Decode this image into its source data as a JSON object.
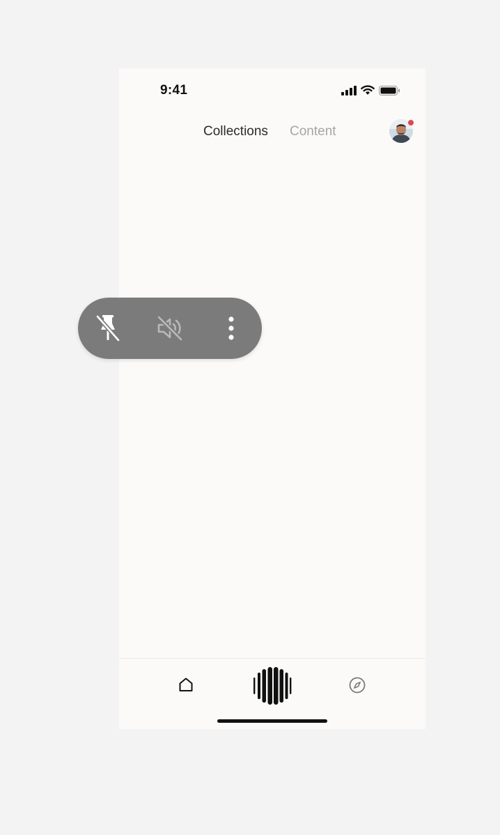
{
  "status_bar": {
    "time": "9:41",
    "icons": [
      "cellular-signal-icon",
      "wifi-icon",
      "battery-icon"
    ]
  },
  "top_nav": {
    "tabs": [
      {
        "label": "Collections",
        "active": true
      },
      {
        "label": "Content",
        "active": false
      }
    ],
    "avatar": {
      "has_notification": true,
      "notification_color": "#e0474c"
    }
  },
  "bottom_nav": {
    "items": [
      "home-icon",
      "voice-orb-icon",
      "compass-icon"
    ]
  },
  "floating_toolbar": {
    "buttons": [
      "unpin-icon",
      "volume-muted-icon",
      "more-vertical-icon"
    ],
    "background": "#7b7b7b"
  },
  "colors": {
    "page_background": "#f3f3f4",
    "phone_background": "#fcfaf9",
    "active_tab": "#2a2a2a",
    "inactive_tab": "#a5a5a5"
  }
}
